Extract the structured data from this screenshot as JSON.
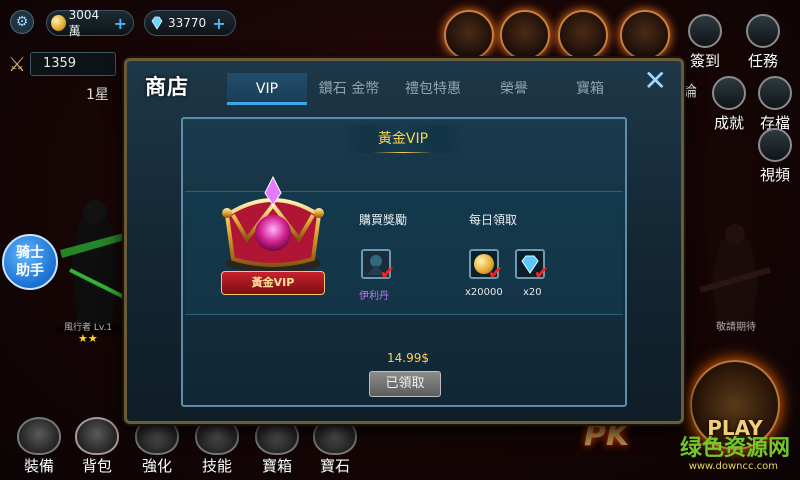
{
  "hud": {
    "gold": "3004萬",
    "gems": "33770",
    "power": "1359",
    "stage": "1星",
    "gold_plus": "+",
    "gems_plus": "+"
  },
  "right_menu": {
    "sign_in": "簽到",
    "tasks": "任務",
    "discuss": "論",
    "achievements": "成就",
    "save": "存檔",
    "video": "視頻",
    "coming_soon": "敬請期待"
  },
  "left": {
    "assistant_line1": "骑士",
    "assistant_line2": "助手",
    "character_name": "風行者 Lv.1",
    "stars": "★★"
  },
  "bottom_bar": {
    "items": [
      {
        "label": "裝備"
      },
      {
        "label": "背包"
      },
      {
        "label": "強化"
      },
      {
        "label": "技能"
      },
      {
        "label": "寶箱"
      },
      {
        "label": "寶石"
      }
    ]
  },
  "shop": {
    "title": "商店",
    "close": "✕",
    "tabs": [
      {
        "label": "VIP",
        "active": true
      },
      {
        "label": "鑽石 金幣",
        "active": false
      },
      {
        "label": "禮包特惠",
        "active": false
      },
      {
        "label": "榮譽",
        "active": false
      },
      {
        "label": "寶箱",
        "active": false
      }
    ],
    "panel": {
      "header": "黃金VIP",
      "ribbon": "黃金VIP",
      "purchase_reward_label": "購買獎勵",
      "daily_label": "每日領取",
      "purchase_rewards": [
        {
          "name": "伊利丹"
        }
      ],
      "daily_rewards": [
        {
          "qty": "x20000",
          "icon": "gold-coin-icon"
        },
        {
          "qty": "x20",
          "icon": "diamond-icon"
        }
      ],
      "price": "14.99$",
      "claim_button": "已領取"
    }
  },
  "pk": {
    "pk_label": "PK",
    "play_label": "PLAY"
  },
  "watermark": {
    "main": "绿色资源网",
    "url": "www.downcc.com"
  }
}
